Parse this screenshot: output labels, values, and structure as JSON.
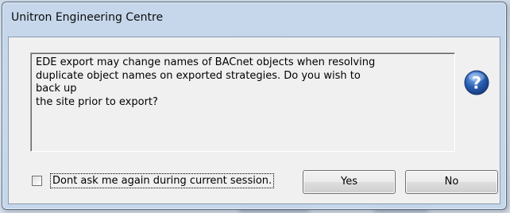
{
  "window": {
    "title": "Unitron Engineering Centre"
  },
  "dialog": {
    "message_lines": [
      "EDE export may change names of BACnet objects when resolving",
      "duplicate object names on exported strategies. Do you wish to back up",
      "the site prior to export?"
    ],
    "icon": "question-icon",
    "checkbox": {
      "label": "Dont ask me again during current session.",
      "checked": false
    },
    "buttons": {
      "yes_label": "Yes",
      "no_label": "No"
    }
  },
  "colors": {
    "frame": "#c4d6ea",
    "client": "#f0f0f0",
    "icon_blue": "#2a5fb4"
  }
}
